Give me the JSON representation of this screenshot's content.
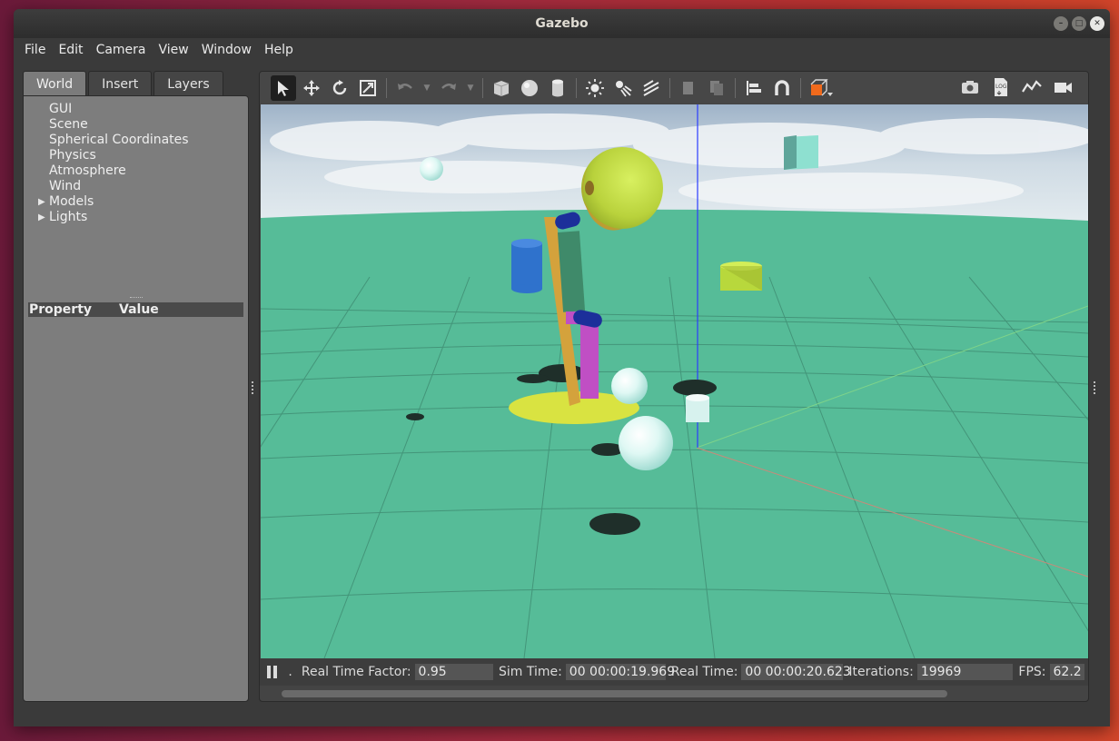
{
  "window": {
    "title": "Gazebo"
  },
  "menu": [
    "File",
    "Edit",
    "Camera",
    "View",
    "Window",
    "Help"
  ],
  "left_tabs": [
    {
      "label": "World",
      "active": true
    },
    {
      "label": "Insert",
      "active": false
    },
    {
      "label": "Layers",
      "active": false
    }
  ],
  "world_tree": [
    {
      "label": "GUI",
      "expandable": false
    },
    {
      "label": "Scene",
      "expandable": false
    },
    {
      "label": "Spherical Coordinates",
      "expandable": false
    },
    {
      "label": "Physics",
      "expandable": false
    },
    {
      "label": "Atmosphere",
      "expandable": false
    },
    {
      "label": "Wind",
      "expandable": false
    },
    {
      "label": "Models",
      "expandable": true
    },
    {
      "label": "Lights",
      "expandable": true
    }
  ],
  "property_table": {
    "col_property": "Property",
    "col_value": "Value"
  },
  "toolbar": {
    "tools": [
      "select-icon",
      "translate-icon",
      "rotate-icon",
      "scale-icon",
      "undo-icon",
      "redo-icon",
      "box-icon",
      "sphere-icon",
      "cylinder-icon",
      "point-light-icon",
      "spot-light-icon",
      "directional-light-icon",
      "copy-icon",
      "paste-icon",
      "align-icon",
      "snap-icon",
      "view-angle-icon"
    ],
    "right_tools": [
      "screenshot-icon",
      "log-icon",
      "plot-icon",
      "record-icon"
    ]
  },
  "status": {
    "step_marker": ".",
    "rtf_label": "Real Time Factor:",
    "rtf_value": "0.95",
    "sim_label": "Sim Time:",
    "sim_value": "00 00:00:19.969",
    "real_label": "Real Time:",
    "real_value": "00 00:00:20.623",
    "iter_label": "Iterations:",
    "iter_value": "19969",
    "fps_label": "FPS:",
    "fps_value": "62.2"
  },
  "colors": {
    "ground": "#56bc98",
    "sky": "#b9c8d6",
    "base_disc": "#d9e341",
    "accent_orange": "#f06a1c"
  }
}
